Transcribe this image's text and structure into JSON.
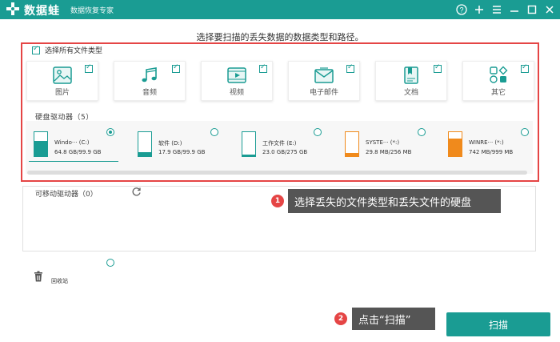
{
  "app": {
    "name": "数据蛙",
    "subtitle": "数据恢复专家",
    "accent": "#1a9c93"
  },
  "window_controls": [
    "help-icon",
    "plus-icon",
    "menu-icon",
    "minimize-icon",
    "maximize-icon",
    "close-icon"
  ],
  "instruction": "选择要扫描的丢失数据的数据类型和路径。",
  "file_types": {
    "select_all_label": "选择所有文件类型",
    "select_all_checked": true,
    "items": [
      {
        "label": "图片",
        "icon": "image-icon",
        "checked": true
      },
      {
        "label": "音频",
        "icon": "music-icon",
        "checked": true
      },
      {
        "label": "视频",
        "icon": "video-icon",
        "checked": true
      },
      {
        "label": "电子邮件",
        "icon": "email-icon",
        "checked": true
      },
      {
        "label": "文档",
        "icon": "document-icon",
        "checked": true
      },
      {
        "label": "其它",
        "icon": "other-icon",
        "checked": true
      }
    ]
  },
  "hard_drives": {
    "title": "硬盘驱动器（5）",
    "items": [
      {
        "name": "Windo··· (C:)",
        "size": "64.8 GB/99.9 GB",
        "used_fraction": 0.65,
        "color": "#1a9c93",
        "selected": true
      },
      {
        "name": "软件 (D:)",
        "size": "17.9 GB/99.9 GB",
        "used_fraction": 0.18,
        "color": "#1a9c93",
        "selected": false
      },
      {
        "name": "工作文件 (E:)",
        "size": "23.0 GB/275 GB",
        "used_fraction": 0.08,
        "color": "#1a9c93",
        "selected": false
      },
      {
        "name": "SYSTE··· (*:)",
        "size": "29.8 MB/256 MB",
        "used_fraction": 0.12,
        "color": "#f08a1c",
        "selected": false
      },
      {
        "name": "WINRE··· (*:)",
        "size": "742 MB/999 MB",
        "used_fraction": 0.74,
        "color": "#f08a1c",
        "selected": false
      }
    ]
  },
  "removable": {
    "title": "可移动驱动器（0）",
    "refresh_icon": "refresh-icon"
  },
  "recycle_bin": {
    "label": "回收站",
    "selected": false
  },
  "callouts": [
    {
      "number": "1",
      "text": "选择丢失的文件类型和丢失文件的硬盘"
    },
    {
      "number": "2",
      "text": "点击“扫描”"
    }
  ],
  "scan_button": "扫描"
}
